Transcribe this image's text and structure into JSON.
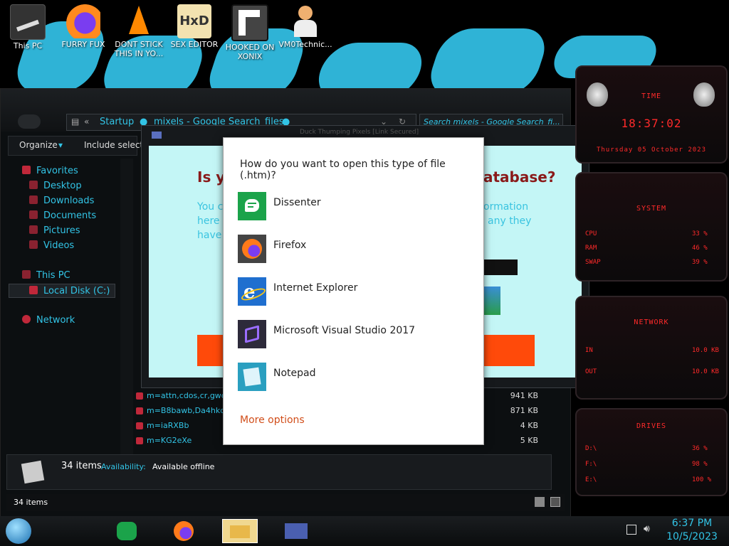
{
  "desktop": {
    "icons": [
      {
        "label": "This PC"
      },
      {
        "label": "FURRY FUX"
      },
      {
        "label": "DONT STICK THIS IN YO..."
      },
      {
        "label": "SEX EDITOR"
      },
      {
        "label": "HOOKED ON XONIX"
      },
      {
        "label": "VM0Technic..."
      }
    ]
  },
  "explorer": {
    "address": {
      "back": "«",
      "crumb1": "Startup",
      "crumb2": "mixels - Google Search_files"
    },
    "search_placeholder": "Search mixels - Google Search_fi...",
    "toolbar": {
      "organize": "Organize",
      "include": "Include select"
    },
    "nav": {
      "favorites": "Favorites",
      "desktop": "Desktop",
      "downloads": "Downloads",
      "documents": "Documents",
      "pictures": "Pictures",
      "videos": "Videos",
      "this_pc": "This PC",
      "local_disk": "Local Disk (C:)",
      "network": "Network"
    },
    "files": [
      {
        "name": "m=attn,cdos,cr,gwc,n...",
        "size": "941 KB"
      },
      {
        "name": "m=B8bawb,Da4hkd,E...",
        "size": "871 KB"
      },
      {
        "name": "m=iaRXBb",
        "size": "4 KB"
      },
      {
        "name": "m=KG2eXe",
        "size": "5 KB"
      }
    ],
    "details": {
      "count": "34 items",
      "availability_label": "Availability:",
      "availability_value": "Available offline"
    },
    "status_count": "34 items"
  },
  "bg_dialog": {
    "title_bar": "Duck Thumping Pixels [Link Secured]",
    "heading_left": "Is yo",
    "heading_right": "atabase?",
    "body_left1": "You c",
    "body_left2": "here a",
    "body_left3": "have",
    "body_right1": "ormation",
    "body_right2": "any they"
  },
  "open_with": {
    "title": "How do you want to open this type of file (.htm)?",
    "apps": [
      {
        "name": "Dissenter",
        "icon": "dissenter-icon"
      },
      {
        "name": "Firefox",
        "icon": "firefox-icon"
      },
      {
        "name": "Internet Explorer",
        "icon": "internet-explorer-icon"
      },
      {
        "name": "Microsoft Visual Studio 2017",
        "icon": "visual-studio-icon"
      },
      {
        "name": "Notepad",
        "icon": "notepad-icon"
      }
    ],
    "more": "More options"
  },
  "gadgets": {
    "time_title": "TIME",
    "time_value": "18:37:02",
    "date_value": "Thursday 05 October 2023",
    "system_title": "SYSTEM",
    "system_rows": [
      {
        "label": "CPU",
        "value": "33 %"
      },
      {
        "label": "RAM",
        "value": "46 %"
      },
      {
        "label": "SWAP",
        "value": "39 %"
      }
    ],
    "network_title": "NETWORK",
    "network_rows": [
      {
        "label": "IN",
        "value": "10.0 KB"
      },
      {
        "label": "OUT",
        "value": "10.0 KB"
      }
    ],
    "drives_title": "DRIVES",
    "drive_rows": [
      {
        "label": "D:\\",
        "value": "36 %"
      },
      {
        "label": "F:\\",
        "value": "98 %"
      },
      {
        "label": "E:\\",
        "value": "100 %"
      }
    ]
  },
  "taskbar": {
    "time": "6:37 PM",
    "date": "10/5/2023"
  },
  "colors": {
    "accent_cyan": "#32c4e6",
    "gadget_red": "#ff2a2a",
    "dialog_bg": "#c4f6f6",
    "more_options": "#d14e1a"
  }
}
